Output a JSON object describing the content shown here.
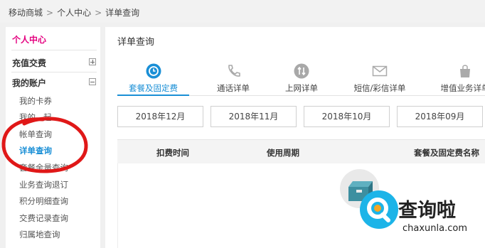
{
  "breadcrumb": {
    "items": [
      "移动商城",
      "个人中心",
      "详单查询"
    ],
    "separator": ">"
  },
  "sidebar": {
    "title": "个人中心",
    "groups": [
      {
        "label": "充值交费",
        "toggle": "plus"
      },
      {
        "label": "我的账户",
        "toggle": "minus"
      }
    ],
    "items": [
      "我的卡券",
      "我的...起",
      "帐单查询",
      "详单查询",
      "套餐余量查询",
      "业务查询退订",
      "积分明细查询",
      "交费记录查询",
      "归属地查询"
    ],
    "active_item": "详单查询"
  },
  "main": {
    "title": "详单查询",
    "tabs": [
      {
        "label": "套餐及固定费",
        "icon": "clock-icon",
        "active": true
      },
      {
        "label": "通话详单",
        "icon": "phone-icon",
        "active": false
      },
      {
        "label": "上网详单",
        "icon": "data-arrows-icon",
        "active": false
      },
      {
        "label": "短信/彩信详单",
        "icon": "envelope-icon",
        "active": false
      },
      {
        "label": "增值业务详单",
        "icon": "shopping-bag-icon",
        "active": false
      }
    ],
    "months": [
      "2018年12月",
      "2018年11月",
      "2018年10月",
      "2018年09月"
    ],
    "table_headers": [
      "扣费时间",
      "使用周期",
      "套餐及固定费名称"
    ]
  },
  "watermark": {
    "name": "查询啦",
    "url": "chaxunla.com"
  },
  "colors": {
    "accent": "#1a8fd6",
    "title_pink": "#e4007f",
    "annotation_red": "#e01818",
    "watermark_blue": "#1cb4e8"
  }
}
